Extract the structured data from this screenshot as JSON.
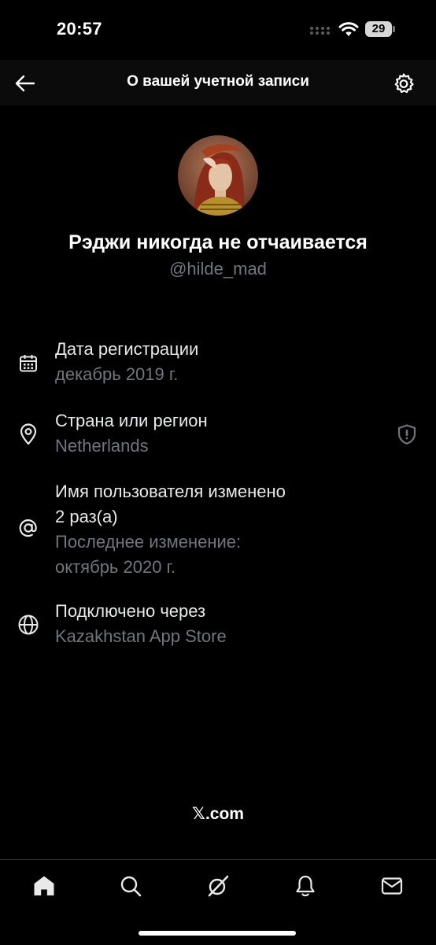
{
  "status_bar": {
    "time": "20:57",
    "battery": "29"
  },
  "header": {
    "title": "О вашей учетной записи",
    "back_icon": "arrow-left-icon",
    "settings_icon": "gear-icon"
  },
  "profile": {
    "display_name": "Рэджи никогда не отчаивается",
    "handle": "@hilde_mad"
  },
  "info_items": [
    {
      "icon": "calendar-icon",
      "title": "Дата регистрации",
      "subtitle": "декабрь 2019 г."
    },
    {
      "icon": "location-pin-icon",
      "title": "Страна или регион",
      "subtitle": "Netherlands",
      "action_icon": "shield-alert-icon"
    },
    {
      "icon": "at-sign-icon",
      "title_line1": "Имя пользователя изменено",
      "title_line2": "2 раз(а)",
      "subtitle_line1": "Последнее изменение:",
      "subtitle_line2": "октябрь 2020 г."
    },
    {
      "icon": "globe-icon",
      "title": "Подключено через",
      "subtitle": "Kazakhstan App Store"
    }
  ],
  "footer": {
    "brand": "𝕏.com"
  },
  "tab_bar": {
    "items": [
      "home-icon",
      "search-icon",
      "grok-icon",
      "bell-icon",
      "mail-icon"
    ]
  },
  "colors": {
    "background": "#000000",
    "primary_text": "#e7e9ea",
    "secondary_text": "#71767b",
    "header_bg": "#0b0b0b"
  }
}
